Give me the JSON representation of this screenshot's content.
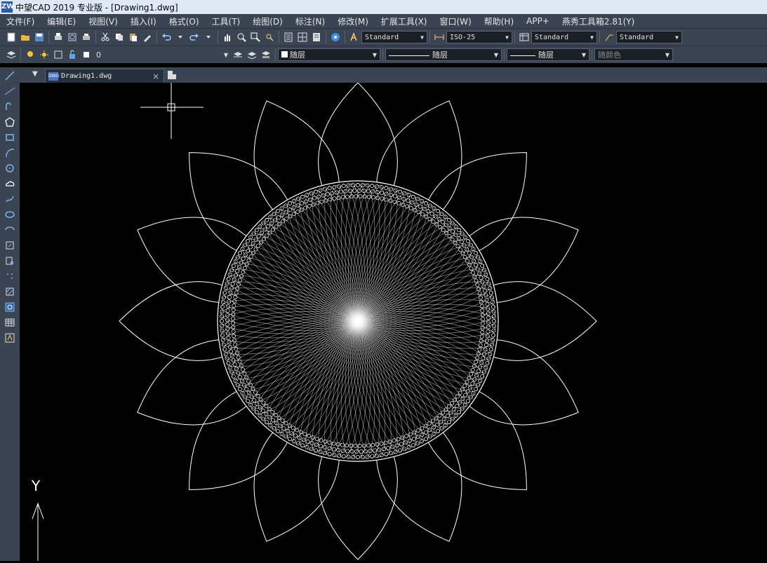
{
  "window": {
    "title": "中望CAD 2019 专业版 - [Drawing1.dwg]",
    "app_icon": "ZW"
  },
  "menu": [
    "文件(F)",
    "编辑(E)",
    "视图(V)",
    "插入(I)",
    "格式(O)",
    "工具(T)",
    "绘图(D)",
    "标注(N)",
    "修改(M)",
    "扩展工具(X)",
    "窗口(W)",
    "帮助(H)",
    "APP+",
    "燕秀工具箱2.81(Y)"
  ],
  "toolbar1": {
    "text_style": "Standard",
    "dim_style": "ISO-25",
    "table_style": "Standard",
    "multileader_style": "Standard"
  },
  "toolbar2": {
    "layer": "0",
    "color": "随层",
    "linetype": "随层",
    "lineweight": "随层",
    "plotstyle": "随颜色"
  },
  "tabs": {
    "active": "Drawing1.dwg",
    "close": "×",
    "dwg_badge": "DWG"
  },
  "canvas": {
    "ucs_y_label": "Y"
  },
  "colors": {
    "chrome": "#3b4453",
    "canvas": "#000000",
    "stroke": "#ffffff"
  }
}
